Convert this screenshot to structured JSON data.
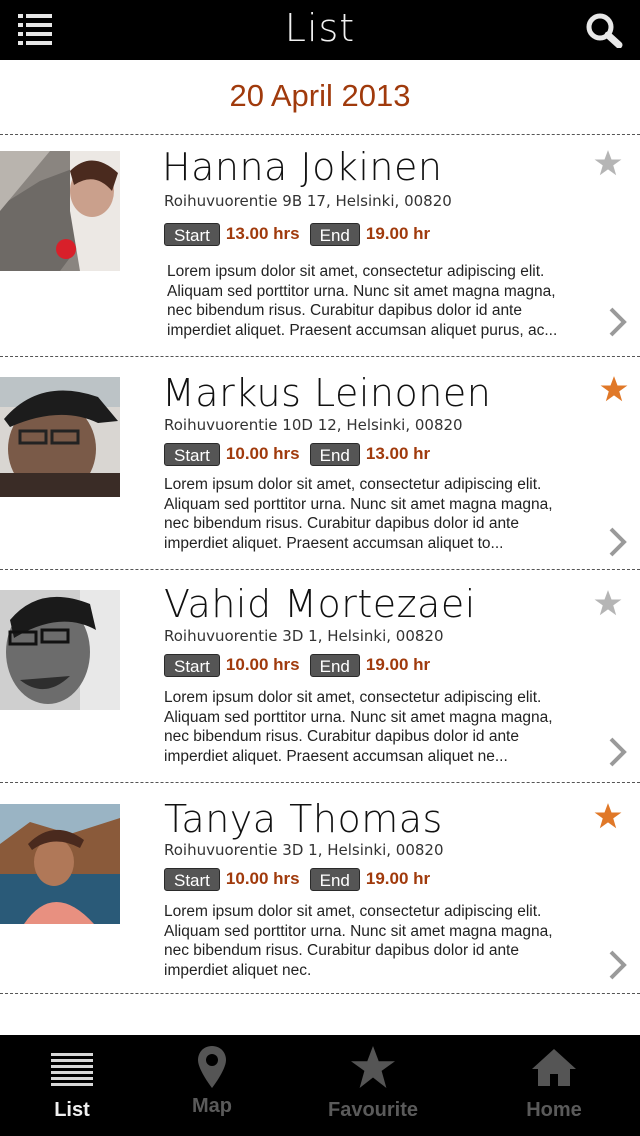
{
  "header": {
    "title": "List"
  },
  "date": "20 April 2013",
  "entries": [
    {
      "name": "Hanna Jokinen",
      "address": "Roihuvuorentie 9B 17, Helsinki, 00820",
      "start_label": "Start",
      "start_time": "13.00 hrs",
      "end_label": "End",
      "end_time": "19.00 hr",
      "description": "Lorem ipsum dolor sit amet, consectetur adipiscing elit. Aliquam sed porttitor urna. Nunc sit amet magna magna, nec bibendum risus. Curabitur dapibus dolor id ante imperdiet aliquet. Praesent accumsan aliquet purus, ac...",
      "favourite": false
    },
    {
      "name": "Markus Leinonen",
      "address": "Roihuvuorentie 10D 12, Helsinki, 00820",
      "start_label": "Start",
      "start_time": "10.00 hrs",
      "end_label": "End",
      "end_time": "13.00 hr",
      "description": "Lorem ipsum dolor sit amet, consectetur adipiscing elit. Aliquam sed porttitor urna. Nunc sit amet magna magna, nec bibendum risus. Curabitur dapibus dolor id ante imperdiet aliquet. Praesent accumsan aliquet  to...",
      "favourite": true
    },
    {
      "name": "Vahid Mortezaei",
      "address": "Roihuvuorentie 3D 1, Helsinki, 00820",
      "start_label": "Start",
      "start_time": "10.00 hrs",
      "end_label": "End",
      "end_time": "19.00 hr",
      "description": "Lorem ipsum dolor sit amet, consectetur adipiscing elit. Aliquam sed porttitor urna. Nunc sit amet magna magna, nec bibendum risus. Curabitur dapibus dolor id ante imperdiet aliquet. Praesent accumsan aliquet ne...",
      "favourite": false
    },
    {
      "name": "Tanya Thomas",
      "address": "Roihuvuorentie 3D 1, Helsinki, 00820",
      "start_label": "Start",
      "start_time": "10.00 hrs",
      "end_label": "End",
      "end_time": "19.00 hr",
      "description": "Lorem ipsum dolor sit amet, consectetur adipiscing elit. Aliquam sed porttitor urna. Nunc sit amet magna magna, nec bibendum risus. Curabitur dapibus dolor id ante imperdiet aliquet nec.",
      "favourite": true
    }
  ],
  "tabs": [
    {
      "label": "List",
      "icon": "list-icon",
      "active": true
    },
    {
      "label": "Map",
      "icon": "map-pin-icon",
      "active": false
    },
    {
      "label": "Favourite",
      "icon": "star-icon",
      "active": false
    },
    {
      "label": "Home",
      "icon": "home-icon",
      "active": false
    }
  ],
  "colors": {
    "accent": "#a03a0c",
    "star_on": "#e07828",
    "star_off": "#b5b5b5"
  }
}
